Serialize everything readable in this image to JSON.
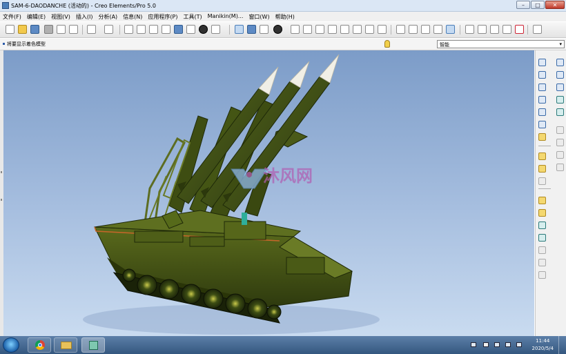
{
  "window": {
    "title": "SAM-6-DAODANCHE (活动的) - Creo Elements/Pro 5.0",
    "minimize": "–",
    "maximize": "□",
    "close": "✕"
  },
  "menu": [
    "文件(F)",
    "编辑(E)",
    "视图(V)",
    "插入(I)",
    "分析(A)",
    "信息(N)",
    "应用程序(P)",
    "工具(T)",
    "Manikin(M)...",
    "窗口(W)",
    "帮助(H)"
  ],
  "status": {
    "message": "将要显示着色模型",
    "filter_value": "智能",
    "filter_arrow": "▾"
  },
  "viewport": {
    "watermark": "沐风网",
    "model": "tracked-missile-launcher"
  },
  "taskbar": {
    "time": "11:44",
    "date": "2020/5/4",
    "apps": [
      "chrome",
      "file-explorer",
      "creo-elements-pro"
    ]
  },
  "colors": {
    "viewport_top": "#7c9cc8",
    "viewport_bottom": "#c9dbf0",
    "hull": "#3d4a14",
    "missile": "#3a4a12",
    "nose": "#f1efe6",
    "taskbar": "#34577f",
    "watermark": "#b15bb0"
  }
}
